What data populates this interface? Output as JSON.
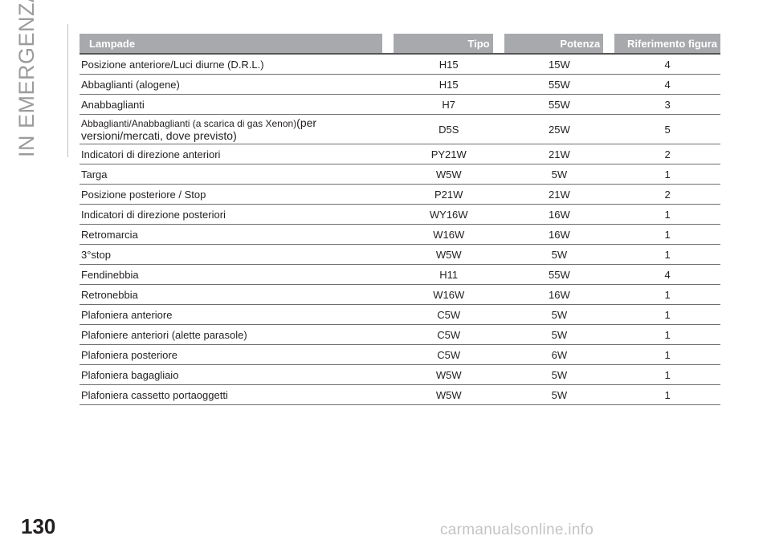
{
  "section_label": "IN EMERGENZA",
  "table": {
    "headers": [
      "Lampade",
      "Tipo",
      "Potenza",
      "Riferimento figura"
    ],
    "rows": [
      [
        "Posizione anteriore/Luci diurne (D.R.L.)",
        "H15",
        "15W",
        "4"
      ],
      [
        "Abbaglianti (alogene)",
        "H15",
        "55W",
        "4"
      ],
      [
        "Anabbaglianti",
        "H7",
        "55W",
        "3"
      ],
      [
        "Abbaglianti/Anabbaglianti (a scarica di gas Xenon)(per versioni/mercati, dove previsto)",
        "D5S",
        "25W",
        "5"
      ],
      [
        "Indicatori di direzione anteriori",
        "PY21W",
        "21W",
        "2"
      ],
      [
        "Targa",
        "W5W",
        "5W",
        "1"
      ],
      [
        "Posizione posteriore / Stop",
        "P21W",
        "21W",
        "2"
      ],
      [
        "Indicatori di direzione posteriori",
        "WY16W",
        "16W",
        "1"
      ],
      [
        "Retromarcia",
        "W16W",
        "16W",
        "1"
      ],
      [
        "3°stop",
        "W5W",
        "5W",
        "1"
      ],
      [
        "Fendinebbia",
        "H11",
        "55W",
        "4"
      ],
      [
        "Retronebbia",
        "W16W",
        "16W",
        "1"
      ],
      [
        "Plafoniera anteriore",
        "C5W",
        "5W",
        "1"
      ],
      [
        "Plafoniere anteriori (alette parasole)",
        "C5W",
        "5W",
        "1"
      ],
      [
        "Plafoniera posteriore",
        "C5W",
        "6W",
        "1"
      ],
      [
        "Plafoniera bagagliaio",
        "W5W",
        "5W",
        "1"
      ],
      [
        "Plafoniera cassetto portaoggetti",
        "W5W",
        "5W",
        "1"
      ]
    ],
    "xenon_row": {
      "part1": "Abbaglianti/Anabbaglianti (a scarica di gas Xenon)",
      "part2": "(per",
      "part3": "versioni/mercati, dove previsto)"
    }
  },
  "page_number": "130",
  "watermark": "carmanualsonline.info"
}
